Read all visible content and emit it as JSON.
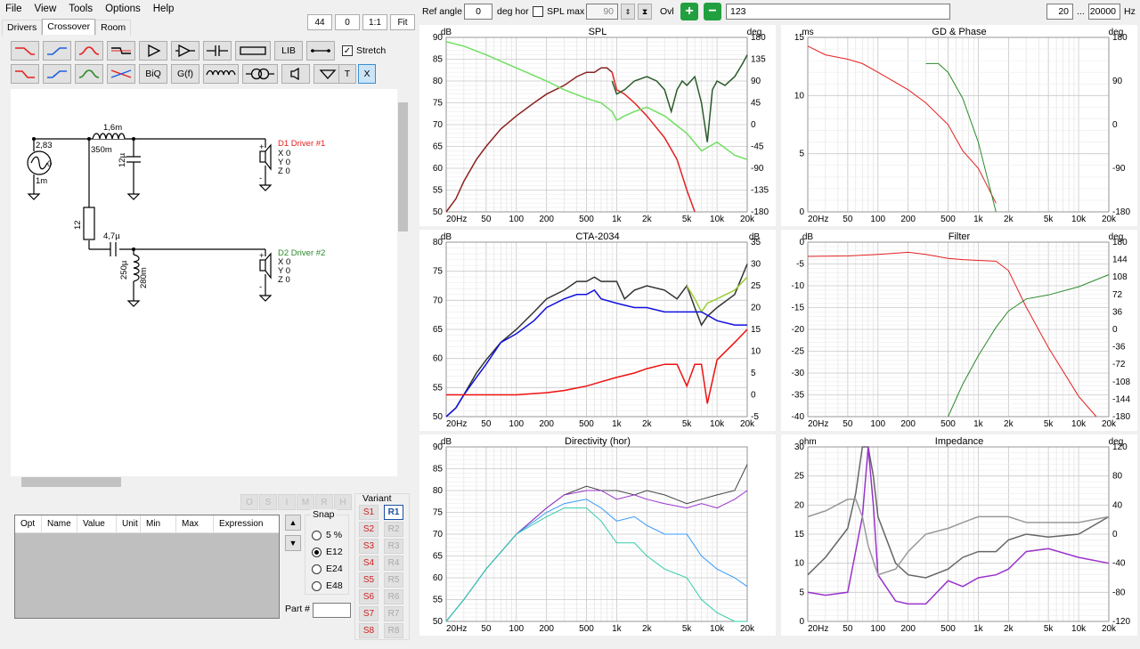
{
  "menu": [
    "File",
    "View",
    "Tools",
    "Options",
    "Help"
  ],
  "zoom": {
    "b1": "44",
    "b2": "0",
    "b3": "1:1",
    "b4": "Fit"
  },
  "tabs": [
    "Drivers",
    "Crossover",
    "Room"
  ],
  "toolbox": {
    "lib": "LIB",
    "stretch": "Stretch",
    "biq": "BiQ",
    "gf": "G(f)",
    "t": "T",
    "x": "X"
  },
  "schematic": {
    "gen_value": "2,83",
    "gen_phase": "0",
    "gen_r": "1m",
    "l1_value": "1,6m",
    "l1_r": "350m",
    "c1_value": "12µ",
    "r1_value": "12",
    "c2_value": "4,7µ",
    "l2_value": "250µ",
    "l2_r": "280m",
    "d1_name": "D1 Driver #1",
    "d1_x": "X 0",
    "d1_y": "Y 0",
    "d1_z": "Z 0",
    "d2_name": "D2 Driver #2",
    "d2_x": "X 0",
    "d2_y": "Y 0",
    "d2_z": "Z 0",
    "plus": "+",
    "minus": "-"
  },
  "osimrh": [
    "O",
    "S",
    "I",
    "M",
    "R",
    "H"
  ],
  "opt_table": {
    "cols": [
      "Opt",
      "Name",
      "Value",
      "Unit",
      "Min",
      "Max",
      "Expression"
    ]
  },
  "snap": {
    "label": "Snap",
    "options": [
      "5 %",
      "E12",
      "E24",
      "E48"
    ],
    "selected": "E12"
  },
  "partno": "Part #",
  "variant": {
    "label": "Variant",
    "s": [
      "S1",
      "S2",
      "S3",
      "S4",
      "S5",
      "S6",
      "S7",
      "S8"
    ],
    "r": [
      "R1",
      "R2",
      "R3",
      "R4",
      "R5",
      "R6",
      "R7",
      "R8"
    ],
    "active": "R1"
  },
  "top": {
    "ref_angle_label": "Ref angle",
    "ref_angle": "0",
    "deg_hor": "deg hor",
    "spl_max_label": "SPL max",
    "spl_max": "90",
    "ovl": "Ovl",
    "name_field": "123",
    "f_min": "20",
    "dots": "...",
    "f_max": "20000",
    "hz": "Hz"
  },
  "colors": {
    "d1": "#e52020",
    "d2": "#2a8a2a",
    "sum": "#555555",
    "grid": "#d2d2d2"
  },
  "freq_labels": [
    "20Hz",
    "50",
    "100",
    "200",
    "500",
    "1k",
    "2k",
    "5k",
    "10k",
    "20k"
  ],
  "charts": {
    "spl": {
      "title": "SPL",
      "yunit": "dB",
      "y2unit": "deg",
      "y": [
        "90",
        "85",
        "80",
        "75",
        "70",
        "65",
        "60",
        "55",
        "50"
      ],
      "y2": [
        "180",
        "135",
        "90",
        "45",
        "0",
        "-45",
        "-90",
        "-135",
        "-180"
      ]
    },
    "gd": {
      "title": "GD & Phase",
      "yunit": "ms",
      "y2unit": "deg",
      "y": [
        "15",
        "10",
        "5",
        "0"
      ],
      "y2": [
        "180",
        "90",
        "0",
        "-90",
        "-180"
      ]
    },
    "cta": {
      "title": "CTA-2034",
      "yunit": "dB",
      "y2unit": "dB",
      "y": [
        "80",
        "75",
        "70",
        "65",
        "60",
        "55",
        "50"
      ],
      "y2": [
        "35",
        "30",
        "25",
        "20",
        "15",
        "10",
        "5",
        "0",
        "-5"
      ]
    },
    "filter": {
      "title": "Filter",
      "yunit": "dB",
      "y2unit": "deg",
      "y": [
        "0",
        "-5",
        "-10",
        "-15",
        "-20",
        "-25",
        "-30",
        "-35",
        "-40"
      ],
      "y2": [
        "180",
        "144",
        "108",
        "72",
        "36",
        "0",
        "-36",
        "-72",
        "-108",
        "-144",
        "-180"
      ]
    },
    "dir": {
      "title": "Directivity (hor)",
      "yunit": "dB",
      "y": [
        "90",
        "85",
        "80",
        "75",
        "70",
        "65",
        "60",
        "55",
        "50"
      ]
    },
    "imp": {
      "title": "Impedance",
      "yunit": "ohm",
      "y2unit": "deg",
      "y": [
        "30",
        "25",
        "20",
        "15",
        "10",
        "5",
        "0"
      ],
      "y2": [
        "120",
        "80",
        "40",
        "0",
        "-40",
        "-80",
        "-120"
      ]
    }
  },
  "chart_data": [
    {
      "type": "line",
      "title": "SPL",
      "ylim": [
        50,
        90
      ],
      "y2lim": [
        -180,
        180
      ],
      "xscale": "log",
      "xlim": [
        20,
        20000
      ],
      "series": [
        {
          "color": "#8b2222",
          "x": [
            20,
            25,
            30,
            40,
            50,
            70,
            100,
            150,
            200,
            300,
            400,
            500,
            600,
            700,
            800,
            900
          ],
          "y": [
            50,
            53,
            57,
            62,
            65,
            69,
            72,
            75,
            77,
            79,
            81,
            82,
            82,
            83,
            83,
            82
          ]
        },
        {
          "color": "#e52020",
          "x": [
            900,
            1000,
            1200,
            1500,
            2000,
            3000,
            4000,
            5000,
            6000
          ],
          "y": [
            82,
            78,
            77,
            75,
            72,
            67,
            62,
            55,
            50
          ]
        },
        {
          "color": "#2a5a2a",
          "x": [
            900,
            1000,
            1200,
            1500,
            2000,
            2500,
            3000,
            3500,
            4000,
            4500,
            5000,
            6000,
            7000,
            8000,
            9000,
            10000,
            12000,
            15000,
            18000,
            20000
          ],
          "y": [
            80,
            77,
            78,
            80,
            81,
            80,
            78,
            73,
            78,
            80,
            79,
            81,
            75,
            66,
            78,
            80,
            79,
            81,
            84,
            86
          ]
        },
        {
          "color": "#70e060",
          "x": [
            20,
            30,
            50,
            100,
            200,
            300,
            500,
            700,
            900,
            1000,
            1200,
            1500,
            2000,
            3000,
            5000,
            7000,
            10000,
            15000,
            20000
          ],
          "y": [
            89,
            88,
            86,
            83,
            80,
            78,
            76,
            75,
            73,
            71,
            72,
            73,
            74,
            72,
            68,
            64,
            66,
            63,
            62
          ]
        }
      ]
    },
    {
      "type": "line",
      "title": "CTA-2034",
      "ylim": [
        50,
        90
      ],
      "y2lim": [
        -5,
        35
      ],
      "xscale": "log",
      "xlim": [
        20,
        20000
      ],
      "series": [
        {
          "color": "#333333",
          "x": [
            20,
            25,
            30,
            40,
            50,
            70,
            100,
            150,
            200,
            300,
            400,
            500,
            600,
            700,
            1000,
            1200,
            1500,
            2000,
            3000,
            4000,
            5000,
            6000,
            7000,
            8000,
            10000,
            15000,
            20000
          ],
          "y": [
            50,
            52,
            55,
            60,
            63,
            67,
            70,
            74,
            77,
            79,
            81,
            81,
            82,
            81,
            81,
            77,
            79,
            80,
            79,
            77,
            80,
            75,
            71,
            73,
            75,
            78,
            85
          ]
        },
        {
          "color": "#9acd32",
          "x": [
            5000,
            6000,
            7000,
            8000,
            10000,
            15000,
            20000
          ],
          "y": [
            80,
            77,
            74,
            76,
            77,
            79,
            82
          ]
        },
        {
          "color": "#1010dd",
          "x": [
            20,
            25,
            30,
            40,
            50,
            70,
            100,
            150,
            200,
            300,
            400,
            500,
            600,
            700,
            1000,
            1500,
            2000,
            3000,
            5000,
            7000,
            10000,
            15000,
            20000
          ],
          "y": [
            50,
            52,
            55,
            59,
            62,
            67,
            69,
            72,
            75,
            77,
            78,
            78,
            79,
            77,
            76,
            75,
            75,
            74,
            74,
            74,
            72,
            71,
            71
          ]
        },
        {
          "color": "#ee1010",
          "x": [
            20,
            50,
            100,
            200,
            300,
            500,
            700,
            1000,
            1500,
            2000,
            3000,
            4000,
            5000,
            6000,
            7000,
            8000,
            10000,
            15000,
            20000
          ],
          "y": [
            55,
            55,
            55,
            55.5,
            56,
            57,
            58,
            59,
            60,
            61,
            62,
            62,
            57,
            62,
            62,
            53,
            63,
            67,
            70
          ]
        }
      ]
    },
    {
      "type": "line",
      "title": "Directivity (hor)",
      "ylim": [
        50,
        90
      ],
      "xscale": "log",
      "xlim": [
        20,
        20000
      ],
      "series": [
        {
          "color": "#444444",
          "x": [
            20,
            30,
            50,
            100,
            200,
            300,
            500,
            700,
            1000,
            1500,
            2000,
            3000,
            5000,
            7000,
            10000,
            15000,
            20000
          ],
          "y": [
            50,
            55,
            62,
            70,
            76,
            79,
            81,
            80,
            80,
            79,
            80,
            79,
            77,
            78,
            79,
            80,
            86
          ]
        },
        {
          "color": "#9933cc",
          "x": [
            20,
            30,
            50,
            100,
            200,
            300,
            500,
            700,
            1000,
            1500,
            2000,
            3000,
            5000,
            7000,
            10000,
            15000,
            20000
          ],
          "y": [
            50,
            55,
            62,
            70,
            76,
            79,
            80,
            80,
            78,
            79,
            78,
            77,
            76,
            77,
            76,
            78,
            80
          ]
        },
        {
          "color": "#3399ff",
          "x": [
            20,
            30,
            50,
            100,
            200,
            300,
            500,
            700,
            1000,
            1500,
            2000,
            3000,
            5000,
            7000,
            10000,
            15000,
            20000
          ],
          "y": [
            50,
            55,
            62,
            70,
            75,
            77,
            78,
            76,
            73,
            74,
            72,
            70,
            70,
            65,
            62,
            60,
            58
          ]
        },
        {
          "color": "#33ccaa",
          "x": [
            20,
            30,
            50,
            100,
            200,
            300,
            500,
            700,
            1000,
            1500,
            2000,
            3000,
            5000,
            7000,
            10000,
            15000,
            20000
          ],
          "y": [
            50,
            55,
            62,
            70,
            74,
            76,
            76,
            73,
            68,
            68,
            65,
            62,
            60,
            55,
            52,
            50,
            50
          ]
        }
      ]
    },
    {
      "type": "line",
      "title": "GD & Phase",
      "ylim": [
        -5,
        15
      ],
      "xscale": "log",
      "xlim": [
        20,
        20000
      ],
      "series": [
        {
          "color": "#e52020",
          "x": [
            20,
            30,
            50,
            70,
            100,
            200,
            300,
            500,
            700,
            1000,
            1500
          ],
          "y": [
            14,
            13,
            12.5,
            12,
            11,
            9,
            7.5,
            5,
            2,
            0,
            -4
          ]
        },
        {
          "color": "#2a8a2a",
          "x": [
            300,
            400,
            500,
            700,
            1000,
            1500
          ],
          "y": [
            12,
            12,
            11,
            8,
            3,
            -5
          ]
        }
      ]
    },
    {
      "type": "line",
      "title": "Filter",
      "ylim": [
        -40,
        3
      ],
      "xscale": "log",
      "xlim": [
        20,
        20000
      ],
      "series": [
        {
          "color": "#e52020",
          "x": [
            20,
            50,
            100,
            200,
            300,
            500,
            700,
            1000,
            1500,
            2000,
            3000,
            5000,
            10000,
            15000
          ],
          "y": [
            -0.5,
            -0.4,
            0,
            0.5,
            0,
            -1,
            -1.3,
            -1.5,
            -1.7,
            -4,
            -13,
            -23,
            -35,
            -40
          ]
        },
        {
          "color": "#2a8a2a",
          "x": [
            500,
            700,
            1000,
            1500,
            2000,
            3000,
            5000,
            10000,
            20000
          ],
          "y": [
            -40,
            -32,
            -25,
            -18,
            -14,
            -11,
            -10,
            -8,
            -5
          ]
        }
      ]
    },
    {
      "type": "line",
      "title": "Impedance",
      "ylim": [
        0,
        30
      ],
      "xscale": "log",
      "xlim": [
        20,
        20000
      ],
      "series": [
        {
          "color": "#666666",
          "x": [
            20,
            30,
            50,
            60,
            70,
            80,
            90,
            100,
            150,
            200,
            300,
            500,
            700,
            1000,
            1500,
            2000,
            3000,
            5000,
            10000,
            20000
          ],
          "y": [
            8,
            11,
            16,
            22,
            30,
            30,
            25,
            18,
            10,
            8,
            7.5,
            9,
            11,
            12,
            12,
            14,
            15,
            14.5,
            15,
            18
          ]
        },
        {
          "color": "#9933cc",
          "x": [
            20,
            30,
            50,
            70,
            80,
            90,
            100,
            150,
            200,
            300,
            500,
            700,
            1000,
            1500,
            2000,
            3000,
            5000,
            10000,
            20000
          ],
          "y": [
            5,
            4.5,
            5,
            18,
            30,
            20,
            8,
            3.5,
            3,
            3,
            7,
            6,
            7.5,
            8,
            9,
            12,
            12.5,
            11,
            10
          ]
        },
        {
          "color": "#999999",
          "x": [
            20,
            30,
            50,
            60,
            70,
            80,
            100,
            150,
            200,
            300,
            500,
            700,
            1000,
            1500,
            2000,
            3000,
            5000,
            10000,
            20000
          ],
          "y": [
            18,
            19,
            21,
            21,
            18,
            13,
            8,
            9,
            12,
            15,
            16,
            17,
            18,
            18,
            18,
            17,
            17,
            17,
            18
          ]
        }
      ]
    }
  ]
}
